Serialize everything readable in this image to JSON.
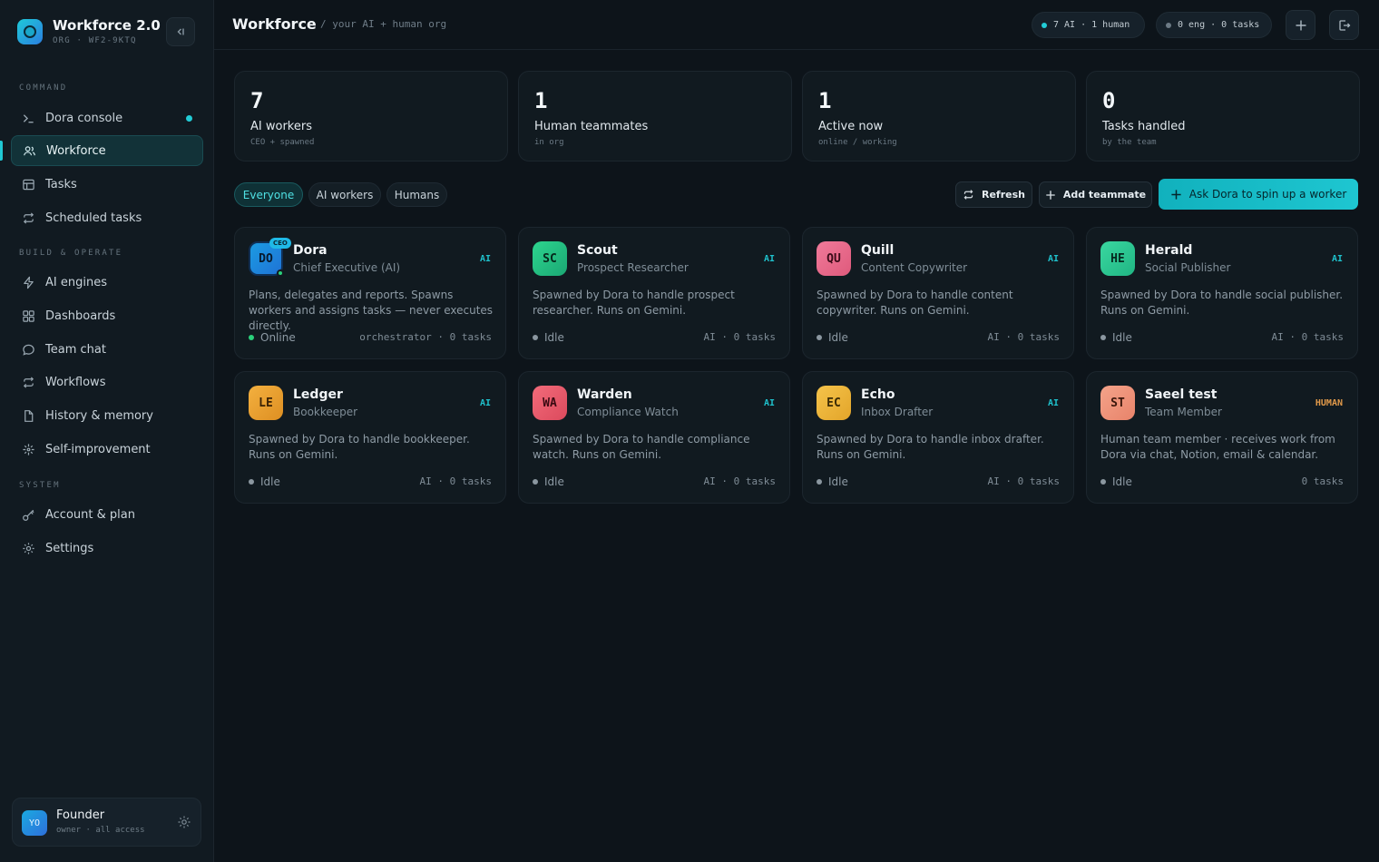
{
  "brand": {
    "title": "Workforce 2.0",
    "subtitle": "ORG · WF2-9KTQ"
  },
  "sidebar": {
    "sections": [
      "COMMAND",
      "BUILD & OPERATE",
      "SYSTEM"
    ],
    "items": [
      {
        "label": "Dora console",
        "icon": "terminal-icon"
      },
      {
        "label": "Workforce",
        "icon": "users-icon",
        "active": true
      },
      {
        "label": "Tasks",
        "icon": "table-icon"
      },
      {
        "label": "Scheduled tasks",
        "icon": "repeat-icon"
      },
      {
        "label": "AI engines",
        "icon": "bolt-icon"
      },
      {
        "label": "Dashboards",
        "icon": "grid-icon"
      },
      {
        "label": "Team chat",
        "icon": "chat-icon"
      },
      {
        "label": "Workflows",
        "icon": "repeat-icon"
      },
      {
        "label": "History & memory",
        "icon": "file-icon"
      },
      {
        "label": "Self-improvement",
        "icon": "sparkle-icon"
      },
      {
        "label": "Account & plan",
        "icon": "key-icon"
      },
      {
        "label": "Settings",
        "icon": "gear-icon"
      }
    ],
    "user": {
      "initials": "YO",
      "name": "Founder",
      "role": "owner · all access"
    }
  },
  "header": {
    "title": "Workforce",
    "subtitle": "/ your AI + human org",
    "status_pill": "7 AI · 1 human",
    "tasks_pill": "0 eng · 0 tasks"
  },
  "stats": [
    {
      "value": "7",
      "label": "AI workers",
      "sub": "CEO + spawned"
    },
    {
      "value": "1",
      "label": "Human teammates",
      "sub": "in org"
    },
    {
      "value": "1",
      "label": "Active now",
      "sub": "online / working"
    },
    {
      "value": "0",
      "label": "Tasks handled",
      "sub": "by the team"
    }
  ],
  "filters": [
    "Everyone",
    "AI workers",
    "Humans"
  ],
  "actions": {
    "refresh": "Refresh",
    "add_teammate": "Add teammate",
    "ask_dora": "Ask Dora to spin up a worker"
  },
  "workers": [
    {
      "initials": "DO",
      "name": "Dora",
      "role": "Chief Executive (AI)",
      "badge": "AI",
      "ceo_badge": "CEO",
      "desc": "Plans, delegates and reports. Spawns workers and assigns tasks — never executes directly.",
      "status": "Online",
      "meta": "orchestrator · 0 tasks"
    },
    {
      "initials": "SC",
      "name": "Scout",
      "role": "Prospect Researcher",
      "badge": "AI",
      "desc": "Spawned by Dora to handle prospect researcher. Runs on Gemini.",
      "status": "Idle",
      "meta": "AI · 0 tasks"
    },
    {
      "initials": "QU",
      "name": "Quill",
      "role": "Content Copywriter",
      "badge": "AI",
      "desc": "Spawned by Dora to handle content copywriter. Runs on Gemini.",
      "status": "Idle",
      "meta": "AI · 0 tasks"
    },
    {
      "initials": "HE",
      "name": "Herald",
      "role": "Social Publisher",
      "badge": "AI",
      "desc": "Spawned by Dora to handle social publisher. Runs on Gemini.",
      "status": "Idle",
      "meta": "AI · 0 tasks"
    },
    {
      "initials": "LE",
      "name": "Ledger",
      "role": "Bookkeeper",
      "badge": "AI",
      "desc": "Spawned by Dora to handle bookkeeper. Runs on Gemini.",
      "status": "Idle",
      "meta": "AI · 0 tasks"
    },
    {
      "initials": "WA",
      "name": "Warden",
      "role": "Compliance Watch",
      "badge": "AI",
      "desc": "Spawned by Dora to handle compliance watch. Runs on Gemini.",
      "status": "Idle",
      "meta": "AI · 0 tasks"
    },
    {
      "initials": "EC",
      "name": "Echo",
      "role": "Inbox Drafter",
      "badge": "AI",
      "desc": "Spawned by Dora to handle inbox drafter. Runs on Gemini.",
      "status": "Idle",
      "meta": "AI · 0 tasks"
    },
    {
      "initials": "ST",
      "name": "Saeel test",
      "role": "Team Member",
      "badge": "HUMAN",
      "desc": "Human team member · receives work from Dora via chat, Notion, email & calendar.",
      "status": "Idle",
      "meta": "0 tasks"
    }
  ],
  "colors": {
    "accent": "#1ec6d1",
    "online": "#2ad07a",
    "human_badge": "#e29a4a"
  }
}
